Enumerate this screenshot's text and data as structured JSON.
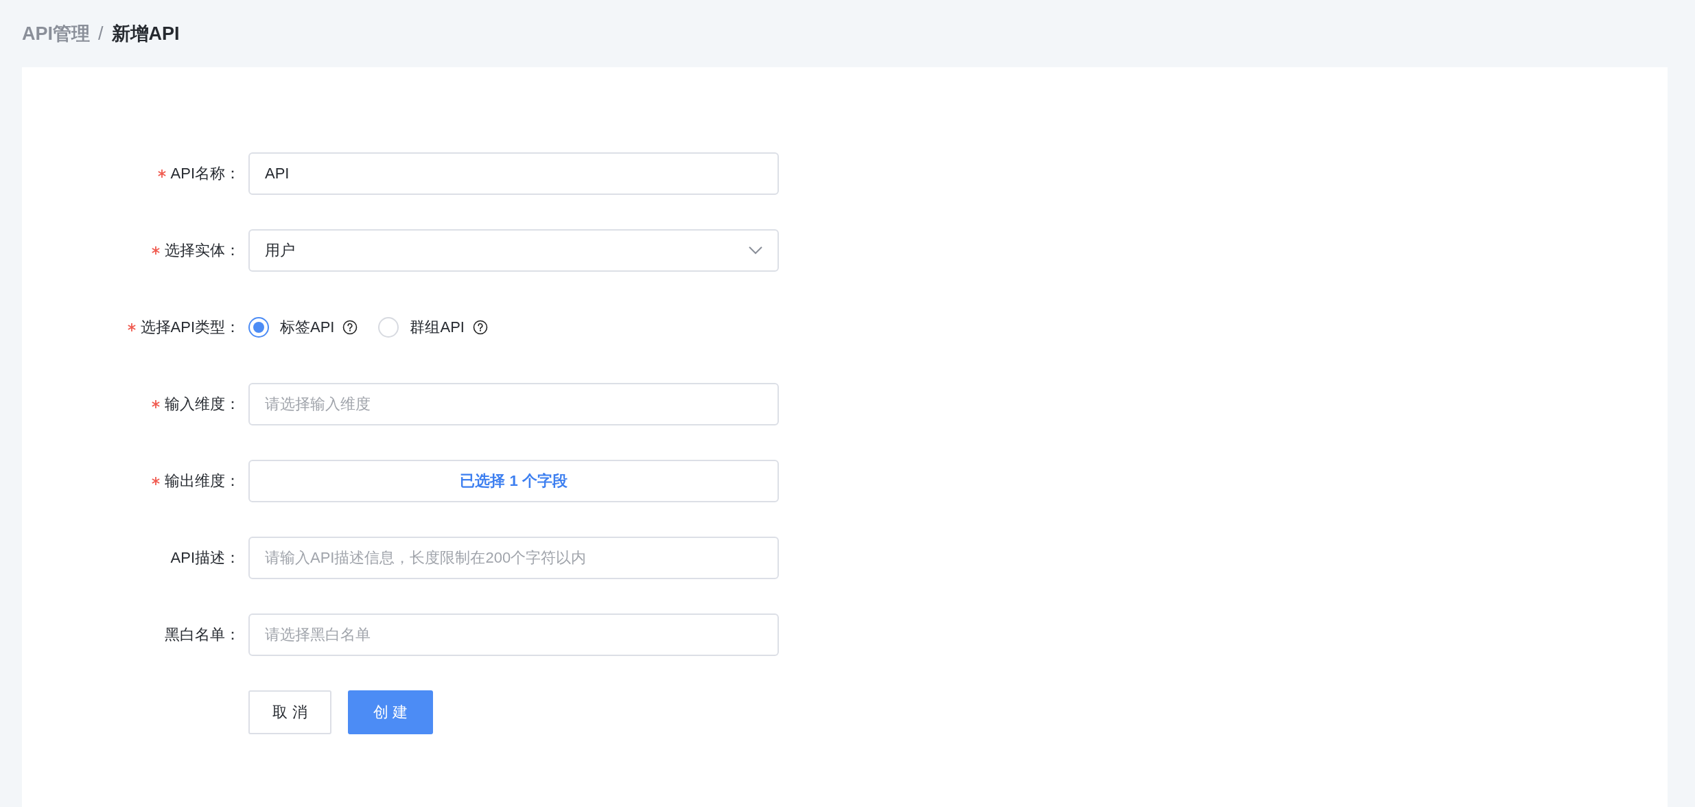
{
  "breadcrumb": {
    "items": [
      {
        "label": "API管理",
        "current": false
      },
      {
        "label": "新增API",
        "current": true
      }
    ],
    "separator": "/"
  },
  "form": {
    "fields": [
      {
        "kind": "input",
        "label": "API名称：",
        "required": true,
        "value": "API"
      },
      {
        "kind": "select",
        "label": "选择实体：",
        "required": true,
        "value": "用户"
      },
      {
        "kind": "radio",
        "label": "选择API类型：",
        "required": true,
        "options": [
          {
            "label": "标签API",
            "selected": true
          },
          {
            "label": "群组API",
            "selected": false
          }
        ]
      },
      {
        "kind": "input",
        "label": "输入维度：",
        "required": true,
        "placeholder": "请选择输入维度"
      },
      {
        "kind": "picker",
        "label": "输出维度：",
        "required": true,
        "value": "已选择 1 个字段"
      },
      {
        "kind": "input",
        "label": "API描述：",
        "required": false,
        "placeholder": "请输入API描述信息，长度限制在200个字符以内"
      },
      {
        "kind": "input",
        "label": "黑白名单：",
        "required": false,
        "placeholder": "请选择黑白名单"
      }
    ],
    "buttons": [
      {
        "label": "取 消",
        "kind": "default"
      },
      {
        "label": "创 建",
        "kind": "primary"
      }
    ]
  }
}
